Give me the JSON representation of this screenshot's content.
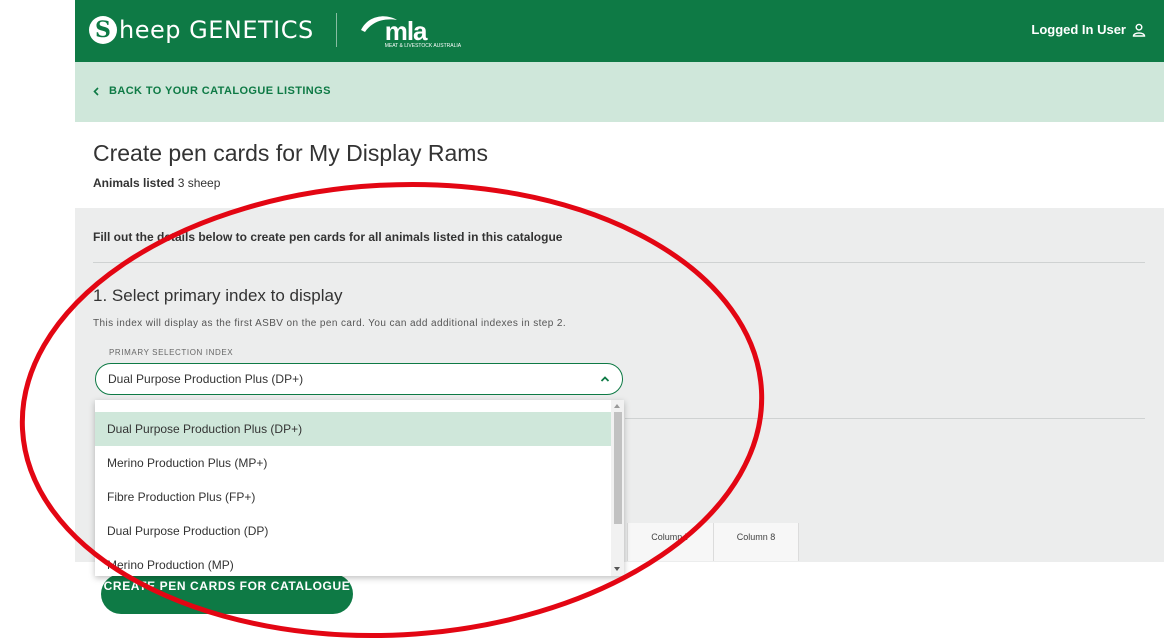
{
  "header": {
    "brand_letter": "S",
    "brand_text": "heep GENETICS",
    "partner_logo_text": "mla",
    "partner_logo_subtext": "MEAT & LIVESTOCK AUSTRALIA",
    "user_label": "Logged In User",
    "user_icon": "user-icon"
  },
  "subnav": {
    "back_label": "BACK TO YOUR CATALOGUE LISTINGS"
  },
  "page": {
    "title": "Create pen cards for My Display Rams",
    "animals_listed_label": "Animals listed",
    "animals_listed_value": "3 sheep"
  },
  "form": {
    "intro": "Fill out the details below to create pen cards for all animals listed in this catalogue",
    "step1_title": "1. Select primary index to display",
    "step1_desc": "This index will display as the first ASBV on the pen card. You can add additional indexes in step 2.",
    "field_label": "PRIMARY SELECTION INDEX",
    "selected_value": "Dual Purpose Production Plus (DP+)",
    "options": [
      "Dual Purpose Production Plus (DP+)",
      "Merino Production Plus (MP+)",
      "Fibre Production Plus (FP+)",
      "Dual Purpose Production (DP)",
      "Merino Production (MP)"
    ],
    "selected_index": 0,
    "columns": [
      "Column 7",
      "Column 8"
    ],
    "create_button": "CREATE PEN CARDS FOR CATALOGUE"
  },
  "colors": {
    "brand_green": "#0e7a45",
    "light_green": "#cfe7da",
    "panel_grey": "#eceded",
    "annotation_red": "#e30613"
  }
}
